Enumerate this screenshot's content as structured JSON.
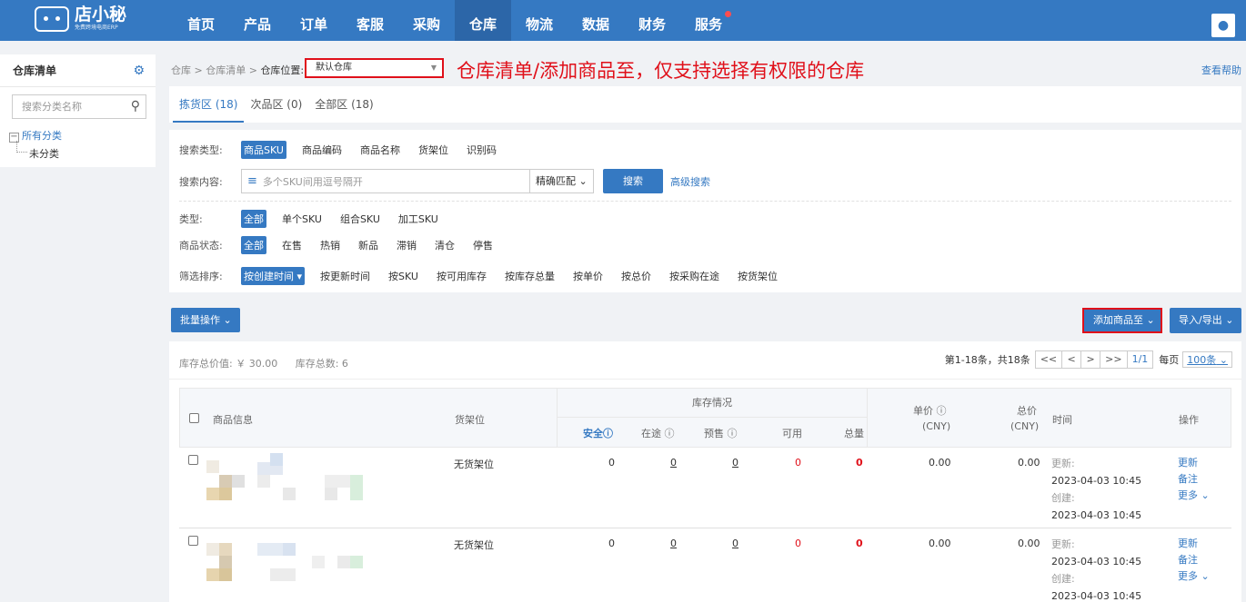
{
  "topnav": {
    "logo_name": "店小秘",
    "logo_sub": "免费跨境电商ERP",
    "menu": [
      "首页",
      "产品",
      "订单",
      "客服",
      "采购",
      "仓库",
      "物流",
      "数据",
      "财务",
      "服务"
    ],
    "active_index": 5
  },
  "sidebar": {
    "title": "仓库清单",
    "search_placeholder": "搜索分类名称",
    "tree_root": "所有分类",
    "tree_child": "未分类"
  },
  "breadcrumb": {
    "items": [
      "仓库",
      "仓库清单",
      "仓库位置:"
    ],
    "warehouse": "默认仓库"
  },
  "annotation": "仓库清单/添加商品至，仅支持选择有权限的仓库",
  "help": "查看帮助",
  "tabs": [
    "拣货区 (18)",
    "次品区 (0)",
    "全部区 (18)"
  ],
  "filters": {
    "search_type_label": "搜索类型:",
    "search_types": [
      "商品SKU",
      "商品编码",
      "商品名称",
      "货架位",
      "识别码"
    ],
    "search_content_label": "搜索内容:",
    "search_placeholder": "多个SKU间用逗号隔开",
    "match_mode": "精确匹配",
    "search_button": "搜索",
    "advanced": "高级搜索",
    "type_label": "类型:",
    "types": [
      "全部",
      "单个SKU",
      "组合SKU",
      "加工SKU"
    ],
    "status_label": "商品状态:",
    "statuses": [
      "全部",
      "在售",
      "热销",
      "新品",
      "滞销",
      "清仓",
      "停售"
    ],
    "sort_label": "筛选排序:",
    "sorts": [
      "按创建时间 ▾",
      "按更新时间",
      "按SKU",
      "按可用库存",
      "按库存总量",
      "按单价",
      "按总价",
      "按采购在途",
      "按货架位"
    ]
  },
  "actions": {
    "batch": "批量操作",
    "add_to": "添加商品至",
    "import_export": "导入/导出"
  },
  "stats": {
    "total_value": "库存总价值: ￥ 30.00",
    "total_count": "库存总数: 6"
  },
  "pager": {
    "info": "第1-18条，共18条",
    "first": "<<",
    "prev": "<",
    "next": ">",
    "last": ">>",
    "page": "1/1",
    "per_page_label": "每页",
    "per_page": "100条"
  },
  "table": {
    "col_product": "商品信息",
    "col_shelf": "货架位",
    "col_stock": "库存情况",
    "col_safe": "安全",
    "col_transit": "在途",
    "col_presale": "预售",
    "col_available": "可用",
    "col_total": "总量",
    "col_unit": "单价",
    "col_totalprice": "总价",
    "col_cny": "(CNY)",
    "col_time": "时间",
    "col_ops": "操作",
    "rows": [
      {
        "shelf": "无货架位",
        "safe": "0",
        "transit": "0",
        "presale": "0",
        "available": "0",
        "total": "0",
        "unit": "0.00",
        "totalprice": "0.00",
        "upd_label": "更新:",
        "upd": "2023-04-03 10:45",
        "cre_label": "创建:",
        "cre": "2023-04-03 10:45",
        "op1": "更新",
        "op2": "备注",
        "op3": "更多"
      },
      {
        "shelf": "无货架位",
        "safe": "0",
        "transit": "0",
        "presale": "0",
        "available": "0",
        "total": "0",
        "unit": "0.00",
        "totalprice": "0.00",
        "upd_label": "更新:",
        "upd": "2023-04-03 10:45",
        "cre_label": "创建:",
        "cre": "2023-04-03 10:45",
        "op1": "更新",
        "op2": "备注",
        "op3": "更多"
      }
    ]
  }
}
